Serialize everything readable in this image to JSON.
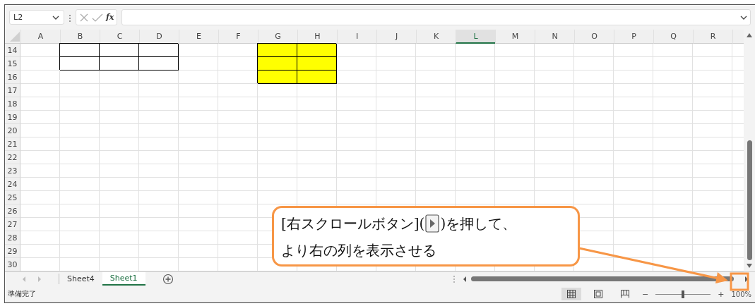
{
  "formula_bar": {
    "name_box": "L2",
    "function_label": "fx"
  },
  "columns": [
    {
      "label": "A",
      "selected": false
    },
    {
      "label": "B",
      "selected": false
    },
    {
      "label": "C",
      "selected": false
    },
    {
      "label": "D",
      "selected": false
    },
    {
      "label": "E",
      "selected": false
    },
    {
      "label": "F",
      "selected": false
    },
    {
      "label": "G",
      "selected": false
    },
    {
      "label": "H",
      "selected": false
    },
    {
      "label": "I",
      "selected": false
    },
    {
      "label": "J",
      "selected": false
    },
    {
      "label": "K",
      "selected": false
    },
    {
      "label": "L",
      "selected": true
    },
    {
      "label": "M",
      "selected": false
    },
    {
      "label": "N",
      "selected": false
    },
    {
      "label": "O",
      "selected": false
    },
    {
      "label": "P",
      "selected": false
    },
    {
      "label": "Q",
      "selected": false
    },
    {
      "label": "R",
      "selected": false
    }
  ],
  "rows": [
    {
      "label": "14",
      "cells": [
        {
          "kind": "plain"
        },
        {
          "kind": "boxed"
        },
        {
          "kind": "boxed"
        },
        {
          "kind": "boxed"
        },
        {
          "kind": "plain"
        },
        {
          "kind": "plain"
        },
        {
          "kind": "filled",
          "color": "#ffff00"
        },
        {
          "kind": "filled",
          "color": "#ffff00"
        }
      ]
    },
    {
      "label": "15",
      "cells": [
        {
          "kind": "plain"
        },
        {
          "kind": "boxed"
        },
        {
          "kind": "boxed"
        },
        {
          "kind": "boxed"
        },
        {
          "kind": "plain"
        },
        {
          "kind": "plain"
        },
        {
          "kind": "filled",
          "color": "#ffff00"
        },
        {
          "kind": "filled",
          "color": "#ffff00"
        }
      ]
    },
    {
      "label": "16",
      "cells": [
        {
          "kind": "plain"
        },
        {
          "kind": "plain"
        },
        {
          "kind": "plain"
        },
        {
          "kind": "plain"
        },
        {
          "kind": "plain"
        },
        {
          "kind": "plain"
        },
        {
          "kind": "filled",
          "color": "#ffff00"
        },
        {
          "kind": "filled",
          "color": "#ffff00"
        }
      ]
    },
    {
      "label": "17"
    },
    {
      "label": "18"
    },
    {
      "label": "19"
    },
    {
      "label": "20"
    },
    {
      "label": "21"
    },
    {
      "label": "22"
    },
    {
      "label": "23"
    },
    {
      "label": "24"
    },
    {
      "label": "25"
    },
    {
      "label": "26"
    },
    {
      "label": "27"
    },
    {
      "label": "28"
    },
    {
      "label": "29"
    },
    {
      "label": "30"
    }
  ],
  "sheet_tabs": [
    {
      "label": "Sheet4",
      "selected": false
    },
    {
      "label": "Sheet1",
      "selected": true
    }
  ],
  "status_bar": {
    "status": "準備完了",
    "views": [
      {
        "kind": "normal",
        "selected": true
      },
      {
        "kind": "page_layout",
        "selected": false
      },
      {
        "kind": "page_break",
        "selected": false
      }
    ],
    "zoom_out": "−",
    "zoom_in": "+",
    "zoom": {
      "level": 0.5
    },
    "zoom_reading": "100%"
  },
  "callout": {
    "line_1_before": "[右スクロールボタン](",
    "line_1_after": ")を押して、",
    "line_2": "より右の列を表示させる"
  }
}
